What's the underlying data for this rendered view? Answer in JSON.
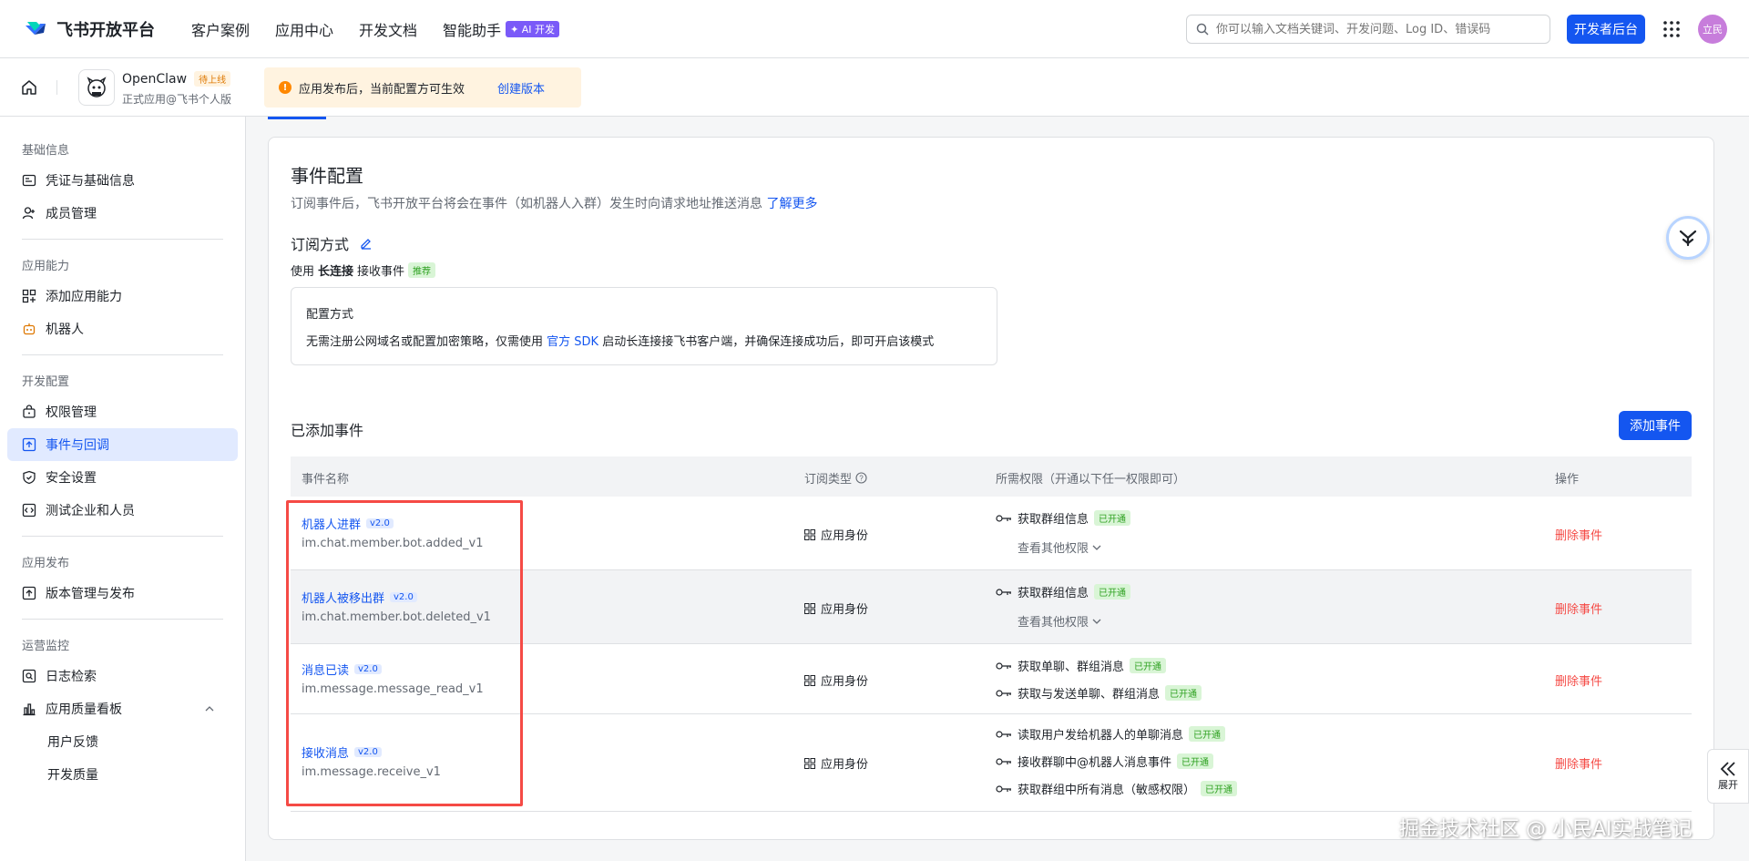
{
  "brand": {
    "name": "飞书开放平台"
  },
  "nav": {
    "items": [
      "客户案例",
      "应用中心",
      "开发文档",
      "智能助手"
    ],
    "ai_badge": "✦ AI 开发"
  },
  "search": {
    "placeholder": "你可以输入文档关键词、开发问题、Log ID、错误码"
  },
  "dev_console": "开发者后台",
  "user": {
    "avatar_text": "立民"
  },
  "app": {
    "name": "OpenClaw",
    "status": "待上线",
    "type": "正式应用@飞书个人版"
  },
  "notice": {
    "text": "应用发布后，当前配置方可生效",
    "action": "创建版本"
  },
  "sidebar": {
    "groups": [
      {
        "title": "基础信息",
        "items": [
          "凭证与基础信息",
          "成员管理"
        ]
      },
      {
        "title": "应用能力",
        "items": [
          "添加应用能力",
          "机器人"
        ]
      },
      {
        "title": "开发配置",
        "items": [
          "权限管理",
          "事件与回调",
          "安全设置",
          "测试企业和人员"
        ]
      },
      {
        "title": "应用发布",
        "items": [
          "版本管理与发布"
        ]
      },
      {
        "title": "运营监控",
        "items": [
          "日志检索",
          "应用质量看板",
          "用户反馈",
          "开发质量"
        ]
      }
    ],
    "active_item": "事件与回调"
  },
  "event_config": {
    "title": "事件配置",
    "desc": "订阅事件后，飞书开放平台将会在事件（如机器人入群）发生时向请求地址推送消息",
    "learn_more": "了解更多",
    "subscribe_title": "订阅方式",
    "mode_prefix": "使用",
    "mode_name": "长连接",
    "mode_suffix": "接收事件",
    "mode_tag": "推荐",
    "config_title": "配置方式",
    "config_text_1": "无需注册公网域名或配置加密策略，仅需使用",
    "config_link": "官方 SDK",
    "config_text_2": "启动长连接接飞书客户端，并确保连接成功后，即可开启该模式"
  },
  "added_events": {
    "title": "已添加事件",
    "add_button": "添加事件",
    "columns": [
      "事件名称",
      "订阅类型",
      "所需权限（开通以下任一权限即可）",
      "操作"
    ],
    "rows": [
      {
        "name": "机器人进群",
        "version": "v2.0",
        "code": "im.chat.member.bot.added_v1",
        "sub_type": "应用身份",
        "perms": [
          {
            "label": "获取群组信息",
            "status": "已开通"
          }
        ],
        "more": "查看其他权限",
        "action": "删除事件"
      },
      {
        "name": "机器人被移出群",
        "version": "v2.0",
        "code": "im.chat.member.bot.deleted_v1",
        "sub_type": "应用身份",
        "perms": [
          {
            "label": "获取群组信息",
            "status": "已开通"
          }
        ],
        "more": "查看其他权限",
        "action": "删除事件"
      },
      {
        "name": "消息已读",
        "version": "v2.0",
        "code": "im.message.message_read_v1",
        "sub_type": "应用身份",
        "perms": [
          {
            "label": "获取单聊、群组消息",
            "status": "已开通"
          },
          {
            "label": "获取与发送单聊、群组消息",
            "status": "已开通"
          }
        ],
        "action": "删除事件"
      },
      {
        "name": "接收消息",
        "version": "v2.0",
        "code": "im.message.receive_v1",
        "sub_type": "应用身份",
        "perms": [
          {
            "label": "读取用户发给机器人的单聊消息",
            "status": "已开通"
          },
          {
            "label": "接收群聊中@机器人消息事件",
            "status": "已开通"
          },
          {
            "label": "获取群组中所有消息（敏感权限）",
            "status": "已开通"
          }
        ],
        "action": "删除事件"
      }
    ]
  },
  "expand": {
    "label": "展开"
  },
  "watermark": "掘金技术社区 @ 小民AI实战笔记",
  "colors": {
    "primary": "#1456f0",
    "danger": "#f54a45",
    "success": "#2ea121",
    "warning": "#ff8800"
  }
}
